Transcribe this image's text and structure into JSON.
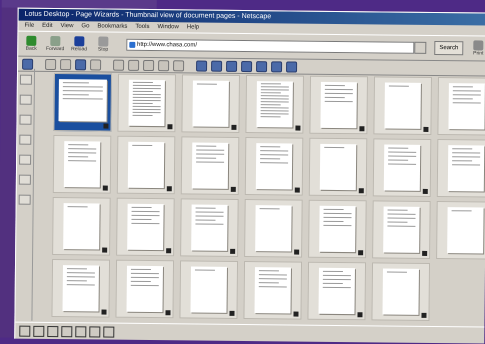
{
  "window": {
    "title": "Lotus Desktop - Page Wizards - Thumbnail view of document pages - Netscape",
    "menu": [
      "File",
      "Edit",
      "View",
      "Go",
      "Bookmarks",
      "Tools",
      "Window",
      "Help"
    ]
  },
  "navigation": {
    "buttons": [
      {
        "label": "Back",
        "icon": "back-arrow-icon",
        "color": "#2e8b2e"
      },
      {
        "label": "Forward",
        "icon": "forward-arrow-icon",
        "color": "#8aa08a"
      },
      {
        "label": "Reload",
        "icon": "reload-icon",
        "color": "#1b3f9a"
      },
      {
        "label": "Stop",
        "icon": "stop-icon",
        "color": "#9a9a9a"
      }
    ],
    "url": "http://www.chasa.com/",
    "search_label": "Search",
    "print_label": "Print"
  },
  "thumbnails": {
    "rows": 4,
    "columns": 7,
    "selected_index": 0,
    "selection_color": "#1a4f9f",
    "dense_pages": [
      1,
      3
    ],
    "empty_slots": [
      27
    ]
  }
}
